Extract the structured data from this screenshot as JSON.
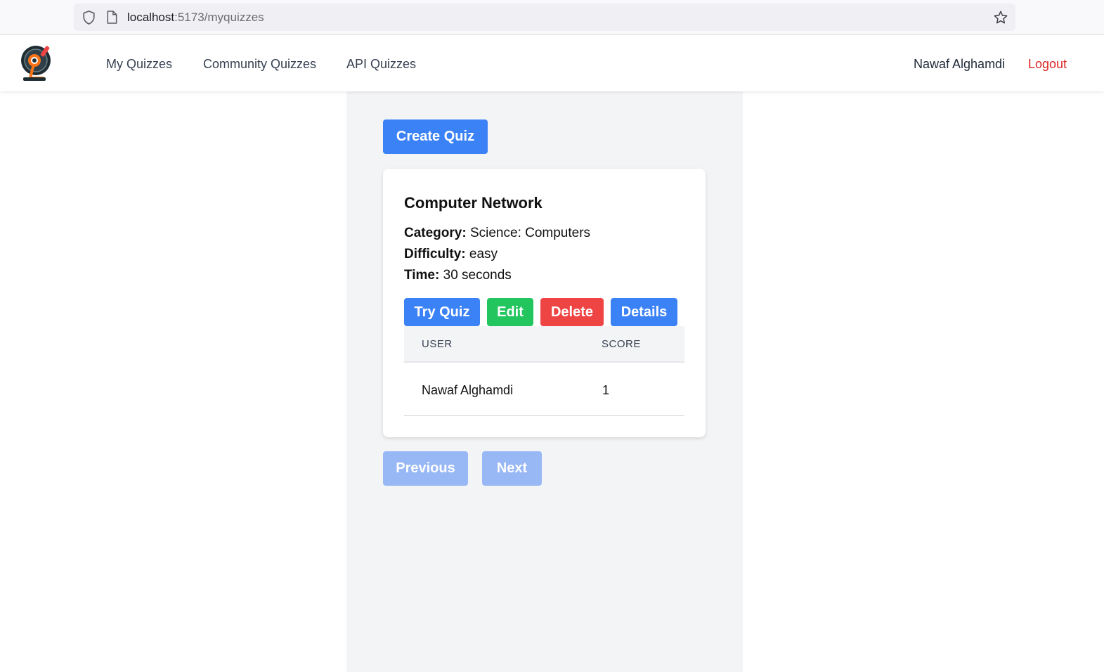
{
  "browser": {
    "url_host": "localhost",
    "url_path": ":5173/myquizzes"
  },
  "nav": {
    "links": [
      "My Quizzes",
      "Community Quizzes",
      "API Quizzes"
    ],
    "user_name": "Nawaf Alghamdi",
    "logout_label": "Logout"
  },
  "main": {
    "create_quiz_label": "Create Quiz",
    "quiz_card": {
      "title": "Computer Network",
      "category_label": "Category:",
      "category_value": "Science: Computers",
      "difficulty_label": "Difficulty:",
      "difficulty_value": "easy",
      "time_label": "Time:",
      "time_value": "30 seconds",
      "actions": {
        "try": "Try Quiz",
        "edit": "Edit",
        "delete": "Delete",
        "details": "Details"
      },
      "table": {
        "headers": [
          "USER",
          "SCORE"
        ],
        "rows": [
          {
            "user": "Nawaf Alghamdi",
            "score": "1"
          }
        ]
      }
    },
    "pagination": {
      "previous_label": "Previous",
      "next_label": "Next"
    }
  },
  "colors": {
    "primary": "#3b82f6",
    "success": "#22c55e",
    "danger": "#ef4444",
    "logout": "#dc2626"
  }
}
